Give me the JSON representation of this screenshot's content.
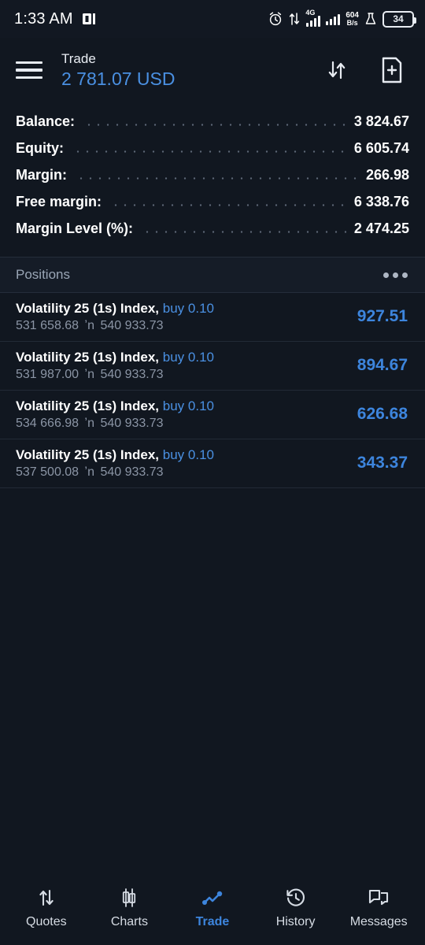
{
  "statusbar": {
    "time": "1:33 AM",
    "app_icon": "app-notification-icon",
    "alarm_icon": "alarm-clock-icon",
    "data_transfer_icon": "data-transfer-icon",
    "network_type": "4G",
    "net_speed_value": "604",
    "net_speed_unit": "B/s",
    "flask_icon": "flask-icon",
    "battery_level": "34"
  },
  "header": {
    "menu_icon": "hamburger-menu-icon",
    "title": "Trade",
    "balance": "2 781.07 USD",
    "sort_icon": "sort-arrows-icon",
    "new_order_icon": "new-document-icon"
  },
  "summary": {
    "rows": [
      {
        "label": "Balance:",
        "value": "3 824.67"
      },
      {
        "label": "Equity:",
        "value": "6 605.74"
      },
      {
        "label": "Margin:",
        "value": "266.98"
      },
      {
        "label": "Free margin:",
        "value": "6 338.76"
      },
      {
        "label": "Margin Level (%):",
        "value": "2 474.25"
      }
    ]
  },
  "positions": {
    "section_title": "Positions",
    "more_icon": "more-options-icon",
    "items": [
      {
        "symbol": "Volatility 25 (1s) Index,",
        "side": "buy 0.10",
        "open_price": "531 658.68",
        "arrow": "ʼn",
        "current_price": "540 933.73",
        "profit": "927.51"
      },
      {
        "symbol": "Volatility 25 (1s) Index,",
        "side": "buy 0.10",
        "open_price": "531 987.00",
        "arrow": "ʼn",
        "current_price": "540 933.73",
        "profit": "894.67"
      },
      {
        "symbol": "Volatility 25 (1s) Index,",
        "side": "buy 0.10",
        "open_price": "534 666.98",
        "arrow": "ʼn",
        "current_price": "540 933.73",
        "profit": "626.68"
      },
      {
        "symbol": "Volatility 25 (1s) Index,",
        "side": "buy 0.10",
        "open_price": "537 500.08",
        "arrow": "ʼn",
        "current_price": "540 933.73",
        "profit": "343.37"
      }
    ]
  },
  "tabbar": {
    "items": [
      {
        "label": "Quotes",
        "icon": "up-down-arrows-icon",
        "active": false
      },
      {
        "label": "Charts",
        "icon": "candlestick-icon",
        "active": false
      },
      {
        "label": "Trade",
        "icon": "line-chart-icon",
        "active": true
      },
      {
        "label": "History",
        "icon": "clock-history-icon",
        "active": false
      },
      {
        "label": "Messages",
        "icon": "chat-bubbles-icon",
        "active": false
      }
    ]
  },
  "colors": {
    "background": "#111720",
    "accent_blue": "#4a90e2",
    "profit_blue": "#3d85dd",
    "muted_text": "#8b95a5",
    "divider": "#222a36"
  }
}
